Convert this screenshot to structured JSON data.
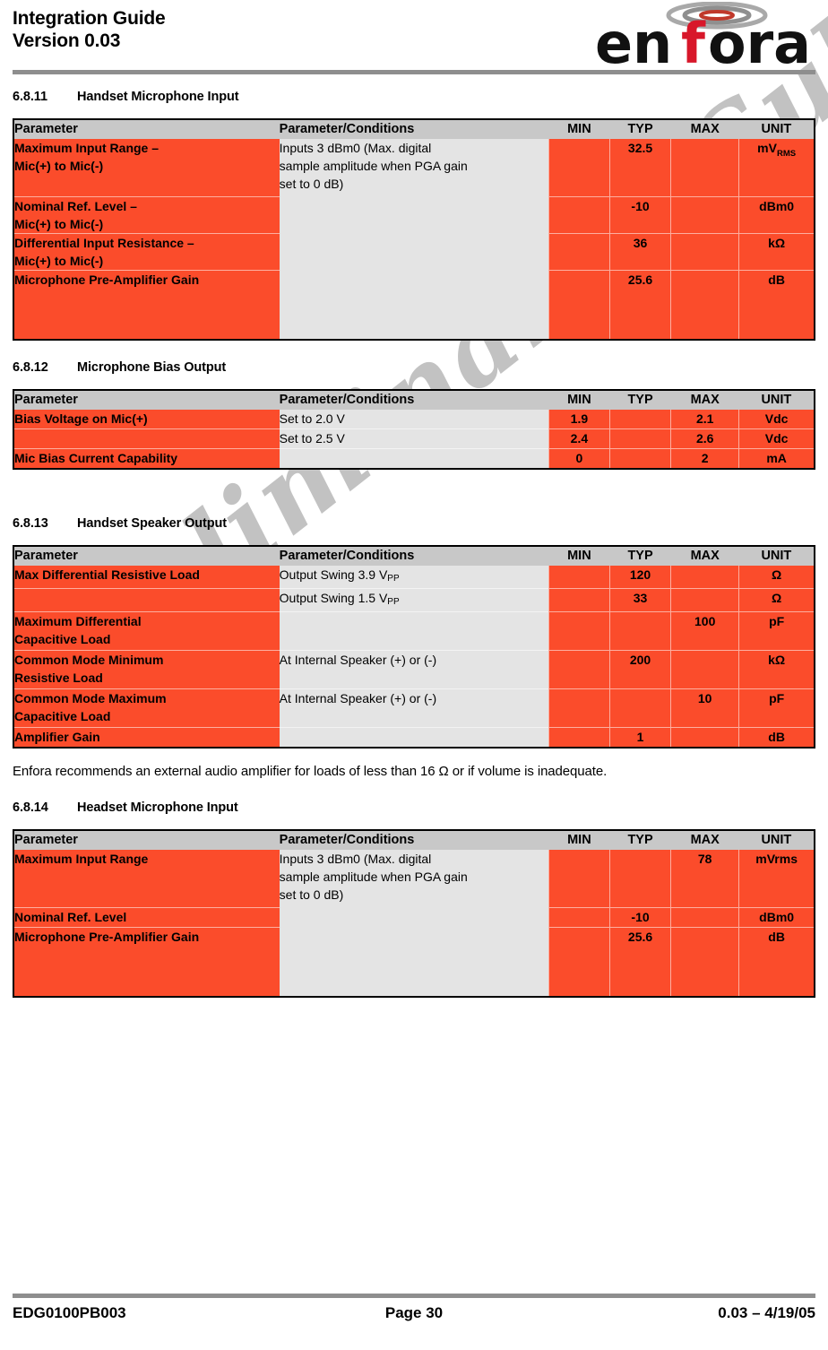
{
  "header": {
    "title": "Integration Guide",
    "version": "Version 0.03",
    "logo_text": "enfora",
    "logo_accent_color": "#d8172a"
  },
  "watermark": {
    "text": "Preliminary – Subject to Change",
    "color": "#c2c2c2"
  },
  "colors": {
    "param_fill": "#fb4c2b",
    "condition_fill": "#e4e4e4",
    "header_fill": "#c8c8c8",
    "rule": "#8e8e8e"
  },
  "columns": {
    "parameter": "Parameter",
    "conditions": "Parameter/Conditions",
    "min": "MIN",
    "typ": "TYP",
    "max": "MAX",
    "unit": "UNIT"
  },
  "sections": [
    {
      "number": "6.8.11",
      "title": "Handset Microphone Input",
      "rows": [
        {
          "parameter": "Maximum Input Range –\nMic(+) to Mic(-)",
          "conditions": "Inputs 3 dBm0 (Max. digital sample amplitude when PGA gain set to 0 dB)",
          "min": "",
          "typ": "32.5",
          "max": "",
          "unit": "mVRMS"
        },
        {
          "parameter": "Nominal Ref. Level –\nMic(+) to Mic(-)",
          "conditions": "",
          "min": "",
          "typ": "-10",
          "max": "",
          "unit": "dBm0"
        },
        {
          "parameter": "Differential Input Resistance –\nMic(+) to Mic(-)",
          "conditions": "",
          "min": "",
          "typ": "36",
          "max": "",
          "unit": "kΩ"
        },
        {
          "parameter": "Microphone Pre-Amplifier Gain",
          "conditions": "",
          "min": "",
          "typ": "25.6",
          "max": "",
          "unit": "dB"
        }
      ]
    },
    {
      "number": "6.8.12",
      "title": "Microphone Bias Output",
      "rows": [
        {
          "parameter": "Bias Voltage on Mic(+)",
          "conditions": "Set to 2.0 V",
          "min": "1.9",
          "typ": "",
          "max": "2.1",
          "unit": "Vdc"
        },
        {
          "parameter": "",
          "conditions": "Set to 2.5 V",
          "min": "2.4",
          "typ": "",
          "max": "2.6",
          "unit": "Vdc"
        },
        {
          "parameter": "Mic Bias Current Capability",
          "conditions": "",
          "min": "0",
          "typ": "",
          "max": "2",
          "unit": "mA"
        }
      ]
    },
    {
      "number": "6.8.13",
      "title": "Handset Speaker Output",
      "rows": [
        {
          "parameter": "Max Differential Resistive Load",
          "conditions": "Output Swing 3.9 VPP",
          "min": "",
          "typ": "120",
          "max": "",
          "unit": "Ω"
        },
        {
          "parameter": "",
          "conditions": "Output Swing 1.5 VPP",
          "min": "",
          "typ": "33",
          "max": "",
          "unit": "Ω"
        },
        {
          "parameter": "Maximum Differential\nCapacitive Load",
          "conditions": "",
          "min": "",
          "typ": "",
          "max": "100",
          "unit": "pF"
        },
        {
          "parameter": "Common Mode Minimum\nResistive Load",
          "conditions": "At Internal Speaker (+) or (-)",
          "min": "",
          "typ": "200",
          "max": "",
          "unit": "kΩ"
        },
        {
          "parameter": "Common Mode Maximum\nCapacitive Load",
          "conditions": "At Internal Speaker (+) or (-)",
          "min": "",
          "typ": "",
          "max": "10",
          "unit": "pF"
        },
        {
          "parameter": "Amplifier Gain",
          "conditions": "",
          "min": "",
          "typ": "1",
          "max": "",
          "unit": "dB"
        }
      ]
    },
    {
      "number": "6.8.14",
      "title": "Headset Microphone Input",
      "rows": [
        {
          "parameter": "Maximum Input Range",
          "conditions": "Inputs 3 dBm0 (Max. digital sample amplitude when PGA gain set to 0 dB)",
          "min": "",
          "typ": "",
          "max": "78",
          "unit": "mVrms"
        },
        {
          "parameter": "Nominal Ref. Level",
          "conditions": "",
          "min": "",
          "typ": "-10",
          "max": "",
          "unit": "dBm0"
        },
        {
          "parameter": "Microphone Pre-Amplifier Gain",
          "conditions": "",
          "min": "",
          "typ": "25.6",
          "max": "",
          "unit": "dB"
        }
      ]
    }
  ],
  "note": "Enfora recommends an external audio amplifier for loads of less than 16 Ω or if volume is inadequate.",
  "footer": {
    "doc_id": "EDG0100PB003",
    "page": "Page 30",
    "revision": "0.03 – 4/19/05"
  }
}
